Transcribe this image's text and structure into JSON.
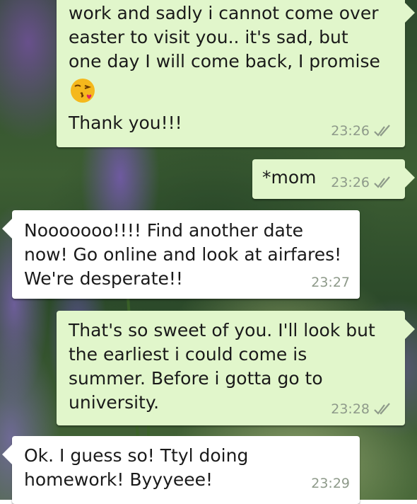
{
  "conversation": {
    "messages": [
      {
        "direction": "outgoing",
        "text": "work and sadly i cannot come over\neaster to visit you.. it's sad, but\none day I will come back, I promise",
        "emoji": "face-blowing-a-kiss",
        "text_after": "Thank you!!!",
        "time": "23:26",
        "status": "read-double-tick"
      },
      {
        "direction": "outgoing",
        "text": "*mom",
        "time": "23:26",
        "status": "read-double-tick"
      },
      {
        "direction": "incoming",
        "text": "Nooooooo!!!! Find another date\nnow! Go online and look at airfares!\nWe're desperate!!",
        "time": "23:27"
      },
      {
        "direction": "outgoing",
        "text": "That's so sweet of you. I'll look but\nthe earliest i could come is\nsummer. Before i gotta go to\nuniversity.",
        "time": "23:28",
        "status": "read-double-tick"
      },
      {
        "direction": "incoming",
        "text": "Ok. I guess so! Ttyl doing\nhomework! Byyyeee!",
        "time": "23:29"
      }
    ]
  },
  "colors": {
    "outgoing_bubble": "#e1f6cb",
    "incoming_bubble": "#ffffff",
    "timestamp": "#8e9a8a",
    "text": "#1a1a1a"
  },
  "icons": {
    "tick": "double-check-icon",
    "emoji": "kiss-emoji-icon"
  }
}
